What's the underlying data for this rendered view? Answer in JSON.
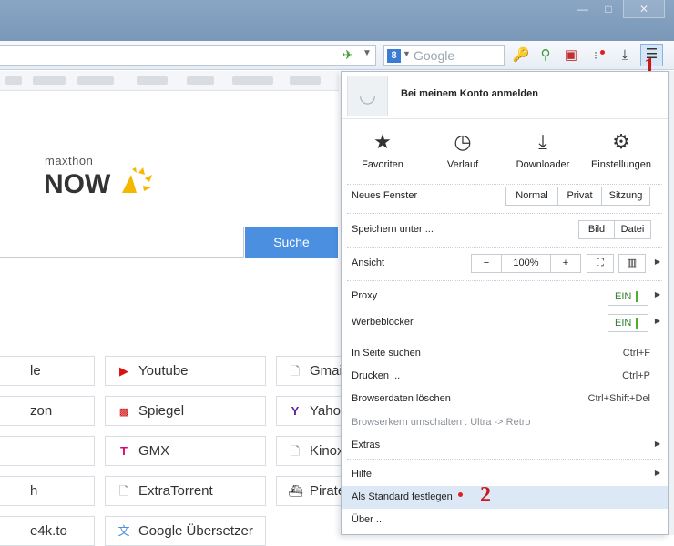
{
  "window": {
    "minimize": "—",
    "maximize": "□",
    "close": "✕"
  },
  "toolbar": {
    "search_placeholder": "Google",
    "engine_letter": "8",
    "icons": [
      "speed-dial-icon",
      "dropdown-icon",
      "key-icon",
      "magnifier-icon",
      "screenshot-icon",
      "snapshot-icon",
      "download-icon",
      "menu-icon"
    ]
  },
  "annotations": {
    "one": "1",
    "two": "2"
  },
  "page": {
    "logo_small": "maxthon",
    "logo_big": "NOW",
    "search_button": "Suche",
    "tiles": [
      {
        "label": "le",
        "icon": ""
      },
      {
        "label": "Youtube",
        "icon": "youtube-icon"
      },
      {
        "label": "Gmai",
        "icon": "page-icon"
      },
      {
        "label": "zon",
        "icon": ""
      },
      {
        "label": "Spiegel",
        "icon": "spiegel-icon"
      },
      {
        "label": "Yaho",
        "icon": "yahoo-icon"
      },
      {
        "label": "",
        "icon": ""
      },
      {
        "label": "GMX",
        "icon": "telekom-icon"
      },
      {
        "label": "Kinox",
        "icon": "page-icon"
      },
      {
        "label": "h",
        "icon": ""
      },
      {
        "label": "ExtraTorrent",
        "icon": "page-icon"
      },
      {
        "label": "Pirate",
        "icon": "pirate-icon"
      },
      {
        "label": "e4k.to",
        "icon": ""
      },
      {
        "label": "Google Übersetzer",
        "icon": "translate-icon"
      }
    ]
  },
  "menu": {
    "account_label": "Bei meinem Konto anmelden",
    "big_buttons": [
      {
        "label": "Favoriten",
        "icon": "star-icon"
      },
      {
        "label": "Verlauf",
        "icon": "clock-icon"
      },
      {
        "label": "Downloader",
        "icon": "download-icon"
      },
      {
        "label": "Einstellungen",
        "icon": "gear-icon"
      }
    ],
    "new_window": {
      "label": "Neues Fenster",
      "options": [
        "Normal",
        "Privat",
        "Sitzung"
      ]
    },
    "save_as": {
      "label": "Speichern unter ...",
      "options": [
        "Bild",
        "Datei"
      ]
    },
    "view": {
      "label": "Ansicht",
      "minus": "−",
      "zoom": "100%",
      "plus": "+",
      "fullscreen": "⛶",
      "split": "▥"
    },
    "proxy": {
      "label": "Proxy",
      "state": "EIN"
    },
    "adblock": {
      "label": "Werbeblocker",
      "state": "EIN"
    },
    "find": {
      "label": "In Seite suchen",
      "shortcut": "Ctrl+F"
    },
    "print": {
      "label": "Drucken ...",
      "shortcut": "Ctrl+P"
    },
    "clear": {
      "label": "Browserdaten löschen",
      "shortcut": "Ctrl+Shift+Del"
    },
    "engine_switch": {
      "label": "Browserkern umschalten : Ultra -> Retro"
    },
    "extras": {
      "label": "Extras"
    },
    "help": {
      "label": "Hilfe"
    },
    "default": {
      "label": "Als Standard festlegen"
    },
    "about": {
      "label": "Über ..."
    }
  },
  "colors": {
    "accent": "#4a8fe0",
    "titlebar": "#7f9bbb",
    "toggle_green": "#4caf30",
    "annotation_red": "#c81818"
  }
}
